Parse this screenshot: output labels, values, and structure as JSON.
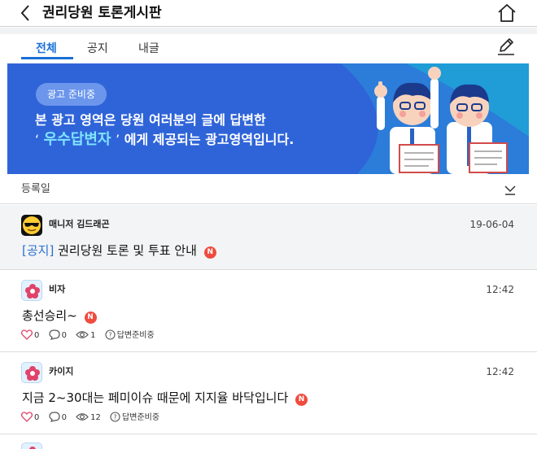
{
  "header": {
    "title": "권리당원 토론게시판",
    "back_icon": "chevron-left-icon",
    "home_icon": "home-icon"
  },
  "tabs": [
    {
      "label": "전체",
      "active": true
    },
    {
      "label": "공지",
      "active": false
    },
    {
      "label": "내글",
      "active": false
    }
  ],
  "write_icon": "pencil-icon",
  "banner": {
    "badge": "광고 준비중",
    "line1": "본 광고 영역은 당원 여러분의 글에 답변한",
    "line2_quote_open": "‘",
    "line2_highlight": "우수답변자",
    "line2_quote_close": "’",
    "line2_rest": "에게 제공되는 광고영역입니다.",
    "bg_color": "#2f64d9"
  },
  "sort": {
    "label": "등록일",
    "icon": "chevron-down-underline-icon"
  },
  "posts": [
    {
      "type": "notice",
      "author": "매니저 김드래곤",
      "avatar": "sunglasses-emoji-icon",
      "time": "19-06-04",
      "tag": "[공지]",
      "title": "권리당원 토론 및 투표 안내",
      "badge": "N"
    },
    {
      "type": "post",
      "author": "비자",
      "avatar": "flower-icon",
      "time": "12:42",
      "title": "총선승리~",
      "badge": "N",
      "likes": "0",
      "comments": "0",
      "views": "1",
      "answer_status": "답변준비중"
    },
    {
      "type": "post",
      "author": "카이지",
      "avatar": "flower-icon",
      "time": "12:42",
      "title": "지금 2~30대는 페미이슈 때문에 지지율 바닥입니다",
      "badge": "N",
      "likes": "0",
      "comments": "0",
      "views": "12",
      "answer_status": "답변준비중"
    }
  ],
  "colors": {
    "accent": "#1a6fd6",
    "new_badge": "#ef4b3f",
    "notice_bg": "#f3f4f6"
  }
}
